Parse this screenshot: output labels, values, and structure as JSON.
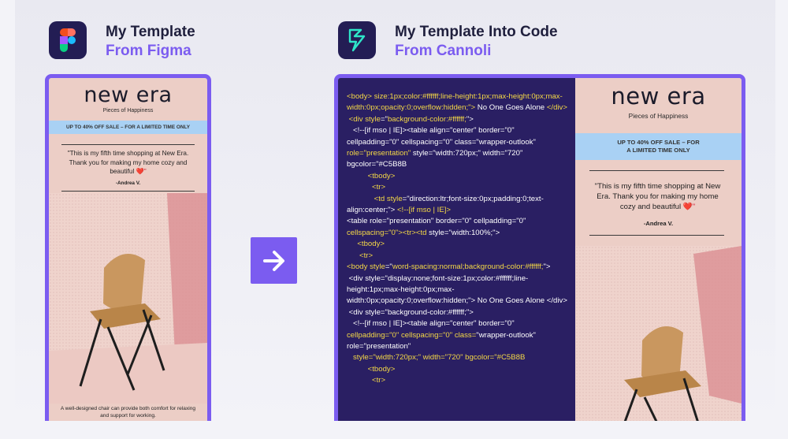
{
  "left": {
    "title": "My Template",
    "subtitle": "From Figma",
    "icon": "figma-logo-icon"
  },
  "right": {
    "title": "My Template Into Code",
    "subtitle": "From Cannoli",
    "icon": "cannoli-logo-icon"
  },
  "arrow": {
    "icon": "arrow-right-icon"
  },
  "email": {
    "logo": "new era",
    "tagline": "Pieces of Happiness",
    "sale_left": "UP TO 40% OFF SALE – FOR A LIMITED TIME ONLY",
    "sale_right_line1": "UP TO 40% OFF SALE – FOR",
    "sale_right_line2": "A LIMITED TIME ONLY",
    "quote": "\"This is my fifth time shopping at New Era. Thank you for making my home cozy and beautiful",
    "heart": "❤️\"",
    "author": "-Andrea V.",
    "footer": "A well-designed chair can provide both comfort for relaxing and support for working."
  },
  "code_lines": [
    [
      [
        "tk",
        "<body> "
      ],
      [
        "attr",
        "size:1px;color:#ffffff;line-height:1px;max-height:0px;max-width:0px;opacity:0;overflow:hidden;\">"
      ],
      [
        "txt",
        " No One Goes Alone "
      ],
      [
        "tk",
        "</div>"
      ]
    ],
    [
      [
        "tk",
        " <div style"
      ],
      [
        "txt",
        "=\""
      ],
      [
        "attr",
        "background-color:#ffffff;"
      ],
      [
        "txt",
        "\">"
      ]
    ],
    [
      [
        "txt",
        "   <!--[if mso | IE]><table align=\"center\" border=\"0\" cellpadding=\"0\" cellspacing=\"0\" class=\"wrapper-outlook\" "
      ],
      [
        "attr",
        "role=\"presentation\""
      ],
      [
        "txt",
        " style=\"width:720px;\" width=\"720\" bgcolor=\"#C5B8B"
      ]
    ],
    [
      [
        "tk",
        "          <tbody>"
      ]
    ],
    [
      [
        "tk",
        "            <tr>"
      ]
    ],
    [
      [
        "tk",
        "             <td style"
      ],
      [
        "txt",
        "=\"direction:ltr;font-size:0px;padding:0;text-align:center;\"> "
      ],
      [
        "tk",
        "<!--[if mso | IE]>"
      ]
    ],
    [
      [
        "txt",
        "<table role=\"presentation\" border=\"0\" cellpadding=\"0\" "
      ],
      [
        "attr",
        "cellspacing=\"0\">"
      ],
      [
        "tk",
        "<tr><td"
      ],
      [
        "txt",
        " style=\"width:100%;\">"
      ]
    ],
    [
      [
        "tk",
        "     <tbody>"
      ]
    ],
    [
      [
        "tk",
        "      <tr>"
      ]
    ],
    [
      [
        "tk",
        "<body style"
      ],
      [
        "txt",
        "=\""
      ],
      [
        "attr",
        "word-spacing:normal;background-color:#ffffff;"
      ],
      [
        "txt",
        "\">"
      ]
    ],
    [
      [
        "txt",
        " <div style=\"display:none;font-size:1px;color:#ffffff;line-height:1px;max-height:0px;max-width:0px;opacity:0;overflow:hidden;\"> No One Goes Alone </div>"
      ]
    ],
    [
      [
        "txt",
        " <div style=\"background-color:#ffffff;\">"
      ]
    ],
    [
      [
        "txt",
        "   <!--[if mso | IE]><table align=\"center\" border=\"0\" "
      ],
      [
        "attr",
        "cellpadding=\"0\" cellspacing=\"0\" class="
      ],
      [
        "txt",
        "\"wrapper-outlook\" role=\"presentation\""
      ]
    ],
    [
      [
        "attr",
        "   style=\"width:720px;\" width=\"720\" bgcolor=\"#C5B8B"
      ]
    ],
    [
      [
        "tk",
        "          <tbody>"
      ]
    ],
    [
      [
        "tk",
        "            <tr>"
      ]
    ]
  ],
  "colors": {
    "accent": "#7b5cf0",
    "code_bg": "#2a1f63",
    "email_bg": "#eccec6",
    "sale_bar": "#a9d1f4"
  }
}
